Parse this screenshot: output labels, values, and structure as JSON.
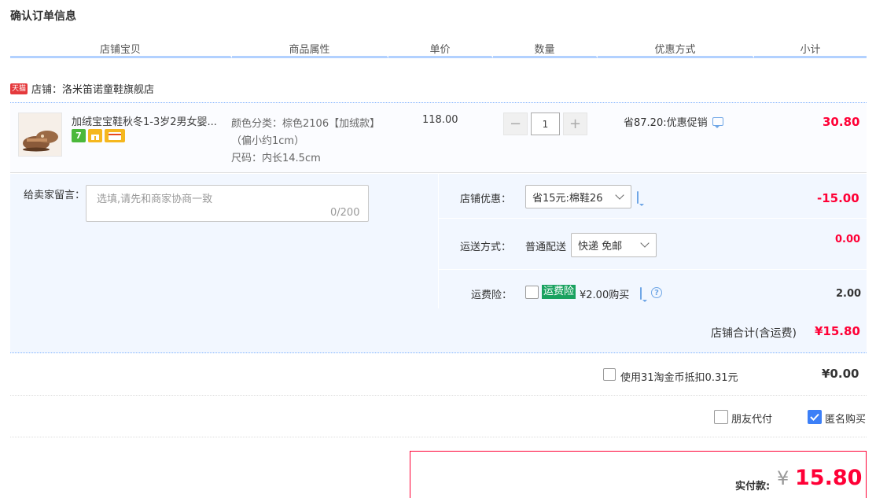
{
  "page_title": "确认订单信息",
  "columns": [
    "店铺宝贝",
    "商品属性",
    "单价",
    "数量",
    "优惠方式",
    "小计"
  ],
  "shop": {
    "badge": "天猫",
    "label": "店铺：洛米笛诺童鞋旗舰店"
  },
  "item": {
    "title": "加绒宝宝鞋秋冬1-3岁2男女婴...",
    "badge_seven": "7",
    "attr_color": "颜色分类：棕色2106【加绒款】",
    "attr_note": "（偏小约1cm）",
    "attr_size": "尺码：内长14.5cm",
    "unit_price": "118.00",
    "quantity": "1",
    "promo": "省87.20:优惠促销",
    "subtotal": "30.80"
  },
  "message": {
    "label": "给卖家留言：",
    "placeholder": "选填,请先和商家协商一致",
    "count": "0/200"
  },
  "shop_discount": {
    "label": "店铺优惠：",
    "selected": "省15元:棉鞋26",
    "value": "-15.00"
  },
  "shipping": {
    "label": "运送方式：",
    "method": "普通配送",
    "selected": "快递 免邮",
    "value": "0.00"
  },
  "insurance": {
    "label": "运费险：",
    "tag": "运费险",
    "text": "¥2.00购买",
    "value": "2.00"
  },
  "shop_total": {
    "label": "店铺合计(含运费)",
    "value": "¥15.80"
  },
  "coins": {
    "label": "使用31淘金币抵扣0.31元",
    "value": "¥0.00"
  },
  "options": {
    "friend_pay": "朋友代付",
    "anonymous": "匿名购买"
  },
  "payment": {
    "label": "实付款:",
    "currency": "¥",
    "amount": "15.80"
  },
  "colors": {
    "accent_red": "#ff0036",
    "header_line": "#b2d1ff",
    "panel_bg": "#f2f7ff",
    "checkbox_blue": "#3c7ff7"
  }
}
